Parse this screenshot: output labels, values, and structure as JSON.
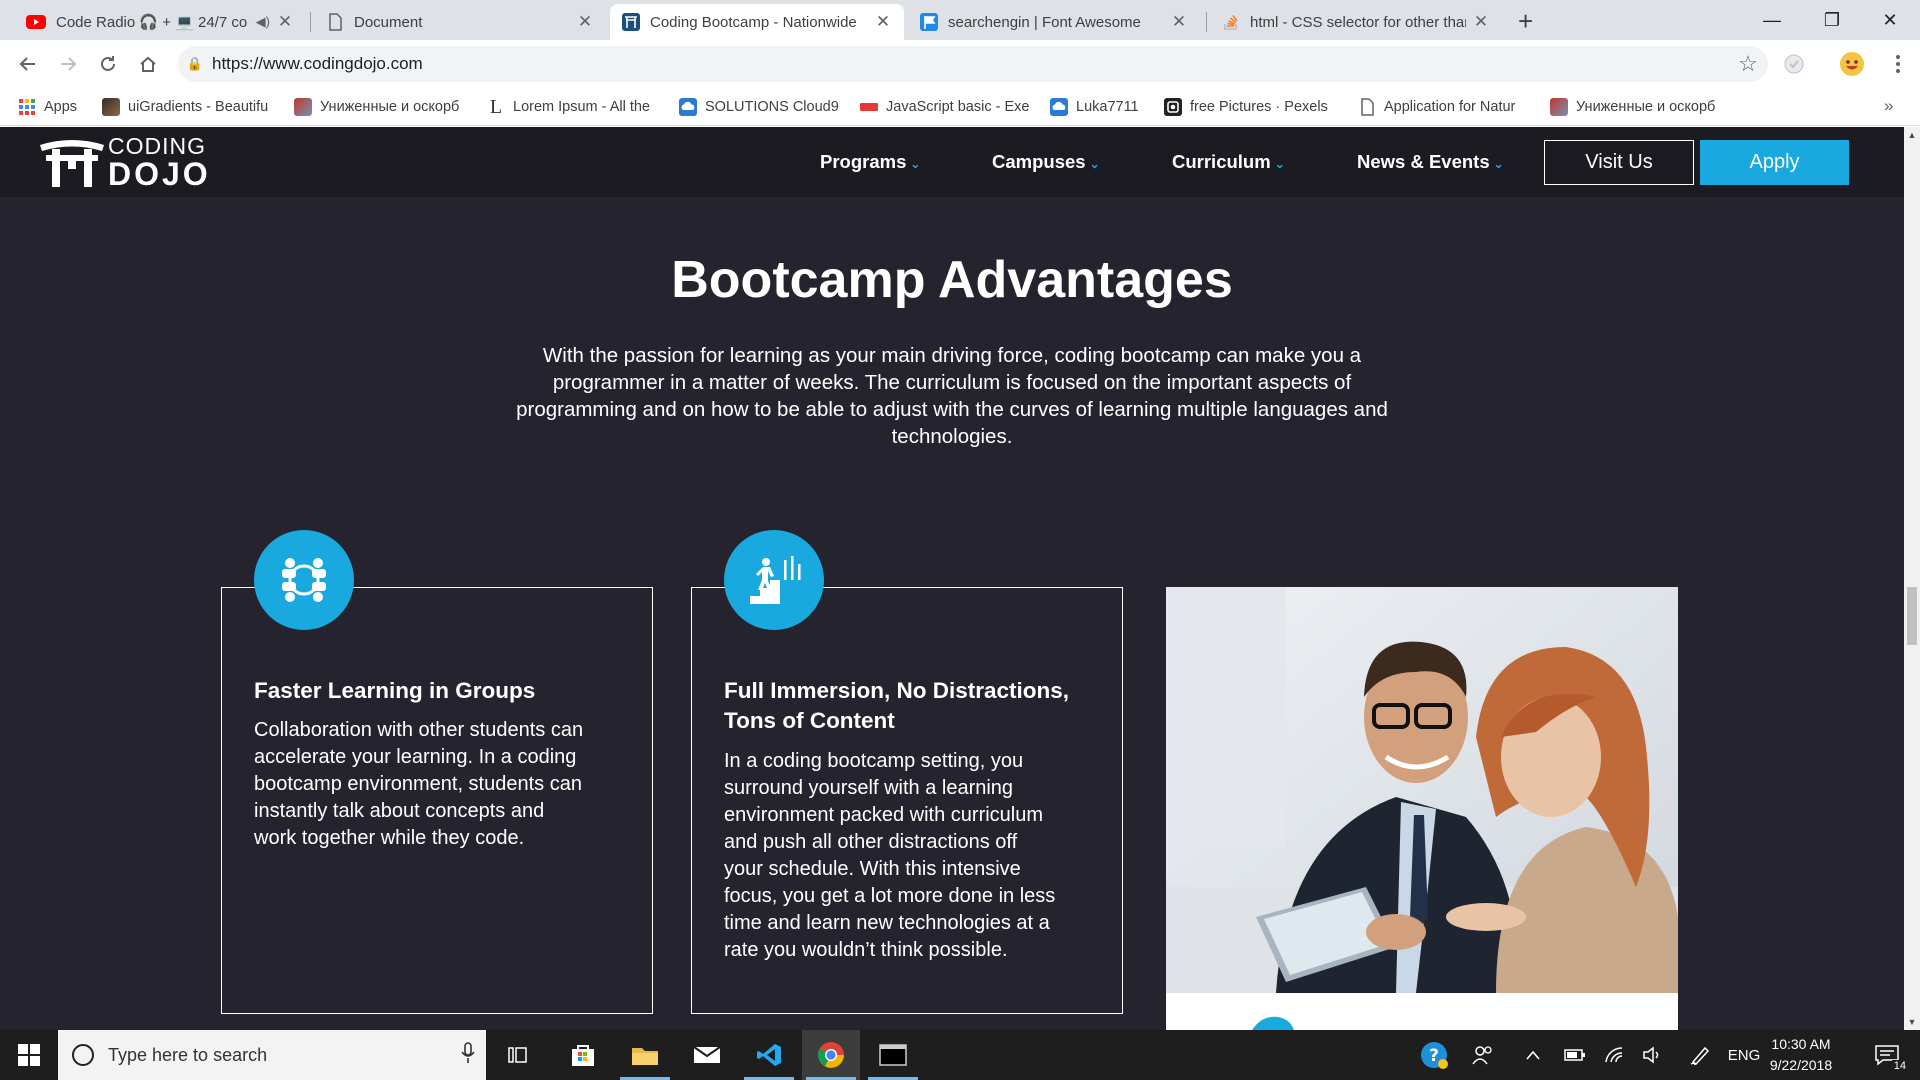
{
  "browser": {
    "tabs": [
      {
        "title": "Code Radio 🎧 + 💻 24/7 co",
        "icon": "youtube-icon",
        "active": false
      },
      {
        "title": "Document",
        "icon": "document-icon",
        "active": false
      },
      {
        "title": "Coding Bootcamp - Nationwide",
        "icon": "coding-dojo-icon",
        "active": true
      },
      {
        "title": "searchengin | Font Awesome",
        "icon": "font-awesome-icon",
        "active": false
      },
      {
        "title": "html - CSS selector for other than",
        "icon": "stackoverflow-icon",
        "active": false
      }
    ],
    "url": "https://www.codingdojo.com",
    "bookmarks": [
      {
        "label": "Apps",
        "icon": "apps-grid-icon"
      },
      {
        "label": "uiGradients - Beautifu",
        "icon": "uigradients-icon"
      },
      {
        "label": "Униженные и оскорб",
        "icon": "book-icon"
      },
      {
        "label": "Lorem Ipsum - All the",
        "icon": "lorem-ipsum-icon"
      },
      {
        "label": "SOLUTIONS Cloud9",
        "icon": "cloud9-icon"
      },
      {
        "label": "JavaScript basic - Exe",
        "icon": "w3resource-icon"
      },
      {
        "label": "Luka7711",
        "icon": "cloud9-icon"
      },
      {
        "label": "free Pictures · Pexels",
        "icon": "pexels-icon"
      },
      {
        "label": "Application for Natur",
        "icon": "document-icon"
      },
      {
        "label": "Униженные и оскорб",
        "icon": "book-icon"
      }
    ]
  },
  "site": {
    "logo": {
      "line1": "CODING",
      "line2": "DOJO",
      "mark": "torii-gate-icon"
    },
    "nav": [
      {
        "label": "Programs"
      },
      {
        "label": "Campuses"
      },
      {
        "label": "Curriculum"
      },
      {
        "label": "News & Events"
      }
    ],
    "visit_label": "Visit Us",
    "apply_label": "Apply",
    "section": {
      "title": "Bootcamp Advantages",
      "intro_lines": [
        "With the passion for learning as your main driving force, coding bootcamp can make you a",
        "programmer in a matter of weeks. The curriculum is focused on the important aspects of",
        "programming and on how to be able to adjust with the curves of learning multiple languages and",
        "technologies."
      ]
    },
    "cards": [
      {
        "icon": "group-collaboration-icon",
        "title_lines": [
          "Faster Learning in Groups"
        ],
        "text_lines": [
          "Collaboration with other students can",
          "accelerate your learning. In a coding",
          "bootcamp environment, students can",
          "instantly talk about concepts and",
          "work together while they code."
        ]
      },
      {
        "icon": "stairs-climbing-icon",
        "title_lines": [
          "Full Immersion, No Distractions,",
          "Tons of Content"
        ],
        "text_lines": [
          "In a coding bootcamp setting, you",
          "surround yourself with a learning",
          "environment packed with curriculum",
          "and push all other distractions off",
          "your schedule. With this intensive",
          "focus, you get a lot more done in less",
          "time and learn new technologies at a",
          "rate you wouldn’t think possible."
        ]
      }
    ],
    "photo": "business-people-with-tablet-photo"
  },
  "taskbar": {
    "search_placeholder": "Type here to search",
    "language": "ENG",
    "time": "10:30 AM",
    "date": "9/22/2018",
    "notifications": "14"
  }
}
